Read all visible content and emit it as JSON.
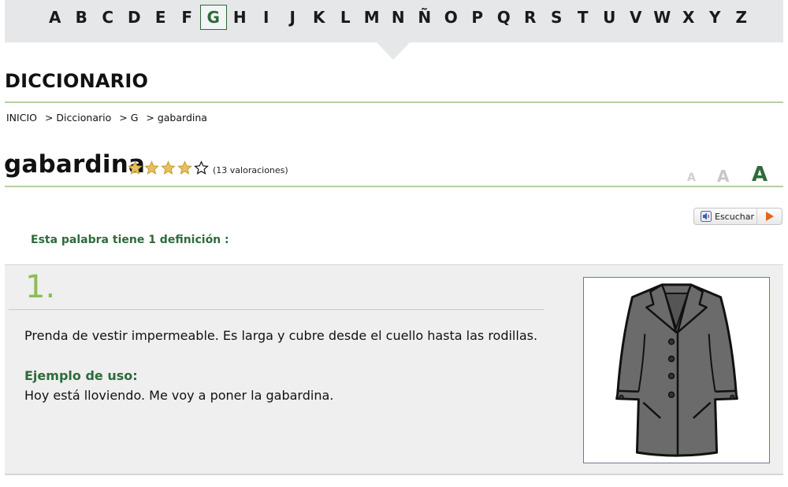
{
  "alphabet": {
    "letters": [
      "A",
      "B",
      "C",
      "D",
      "E",
      "F",
      "G",
      "H",
      "I",
      "J",
      "K",
      "L",
      "M",
      "N",
      "Ñ",
      "O",
      "P",
      "Q",
      "R",
      "S",
      "T",
      "U",
      "V",
      "W",
      "X",
      "Y",
      "Z"
    ],
    "active": "G"
  },
  "section_title": "DICCIONARIO",
  "breadcrumb": {
    "home": "INICIO",
    "dictionary": "> Diccionario",
    "letter": "> G",
    "current": "> gabardina"
  },
  "entry": {
    "word": "gabardina",
    "rating": 4,
    "rating_max": 5,
    "ratings_count": "(13 valoraciones)"
  },
  "font_size_controls": [
    "A",
    "A",
    "A"
  ],
  "listen_button": {
    "label": "Escuchar"
  },
  "definitions_count": "Esta palabra tiene 1 definición :",
  "definition": {
    "number": "1.",
    "text": "Prenda de vestir impermeable. Es larga y cubre desde el cuello hasta las rodillas.",
    "example_label": "Ejemplo de uso:",
    "example": "Hoy está lloviendo. Me voy a poner la gabardina.",
    "image_icon": "coat-illustration"
  },
  "colors": {
    "accent_green": "#2e6b3a",
    "number_green": "#8bbd5a",
    "star_gold": "#e8c15c",
    "rule_green": "#b8cfa3",
    "play_orange": "#e2661c"
  }
}
